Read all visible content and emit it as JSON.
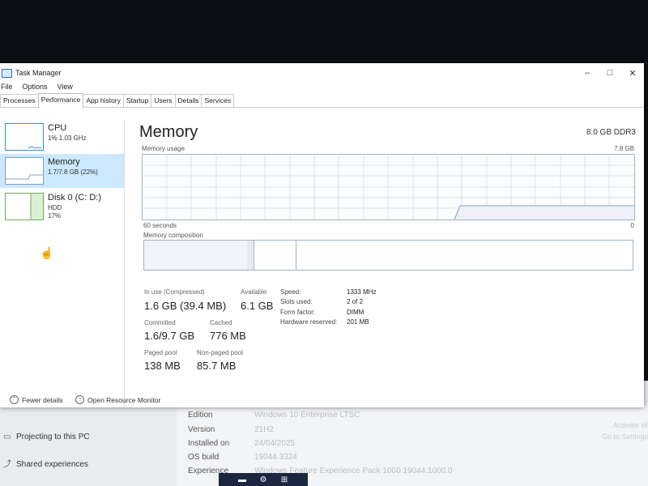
{
  "window": {
    "title": "Task Manager",
    "controls": {
      "minimize": "–",
      "maximize": "□",
      "close": "✕"
    }
  },
  "menu": [
    "File",
    "Options",
    "View"
  ],
  "tabs": [
    {
      "label": "Processes",
      "active": false
    },
    {
      "label": "Performance",
      "active": true
    },
    {
      "label": "App history",
      "active": false
    },
    {
      "label": "Startup",
      "active": false
    },
    {
      "label": "Users",
      "active": false
    },
    {
      "label": "Details",
      "active": false
    },
    {
      "label": "Services",
      "active": false
    }
  ],
  "sidebar": {
    "items": [
      {
        "title": "CPU",
        "sub1": "1% 1.03 GHz",
        "sub2": ""
      },
      {
        "title": "Memory",
        "sub1": "1.7/7.8 GB (22%)",
        "sub2": ""
      },
      {
        "title": "Disk 0 (C: D:)",
        "sub1": "HDD",
        "sub2": "17%"
      }
    ]
  },
  "memory": {
    "title": "Memory",
    "spec": "8.0 GB DDR3",
    "usage_label": "Memory usage",
    "usage_max": "7.8 GB",
    "time_label": "60 seconds",
    "time_end": "0",
    "composition_label": "Memory composition",
    "stats": {
      "in_use_label": "In use (Compressed)",
      "in_use_value": "1.6 GB (39.4 MB)",
      "available_label": "Available",
      "available_value": "6.1 GB",
      "committed_label": "Committed",
      "committed_value": "1.6/9.7 GB",
      "cached_label": "Cached",
      "cached_value": "776 MB",
      "paged_label": "Paged pool",
      "paged_value": "138 MB",
      "nonpaged_label": "Non-paged pool",
      "nonpaged_value": "85.7 MB"
    },
    "specs": {
      "speed_label": "Speed:",
      "speed_value": "1333 MHz",
      "slots_label": "Slots used:",
      "slots_value": "2 of 2",
      "form_label": "Form factor:",
      "form_value": "DIMM",
      "reserved_label": "Hardware reserved:",
      "reserved_value": "201 MB"
    }
  },
  "footer": {
    "fewer_details": "Fewer details",
    "resource_monitor": "Open Resource Monitor"
  },
  "background": {
    "left_items": [
      "Projecting to this PC",
      "Shared experiences"
    ],
    "rows": [
      {
        "key": "Edition",
        "value": "Windows 10 Enterprise LTSC"
      },
      {
        "key": "Version",
        "value": "21H2"
      },
      {
        "key": "Installed on",
        "value": "24/04/2025"
      },
      {
        "key": "OS build",
        "value": "19044.3324"
      },
      {
        "key": "Experience",
        "value": "Windows Feature Experience Pack 1000.19044.1000.0"
      }
    ],
    "watermark_1": "Activate W",
    "watermark_2": "Go to Settings"
  },
  "colors": {
    "accent": "#cde8ff",
    "memory_line": "#8a9fc0",
    "disk_line": "#6cac57"
  }
}
